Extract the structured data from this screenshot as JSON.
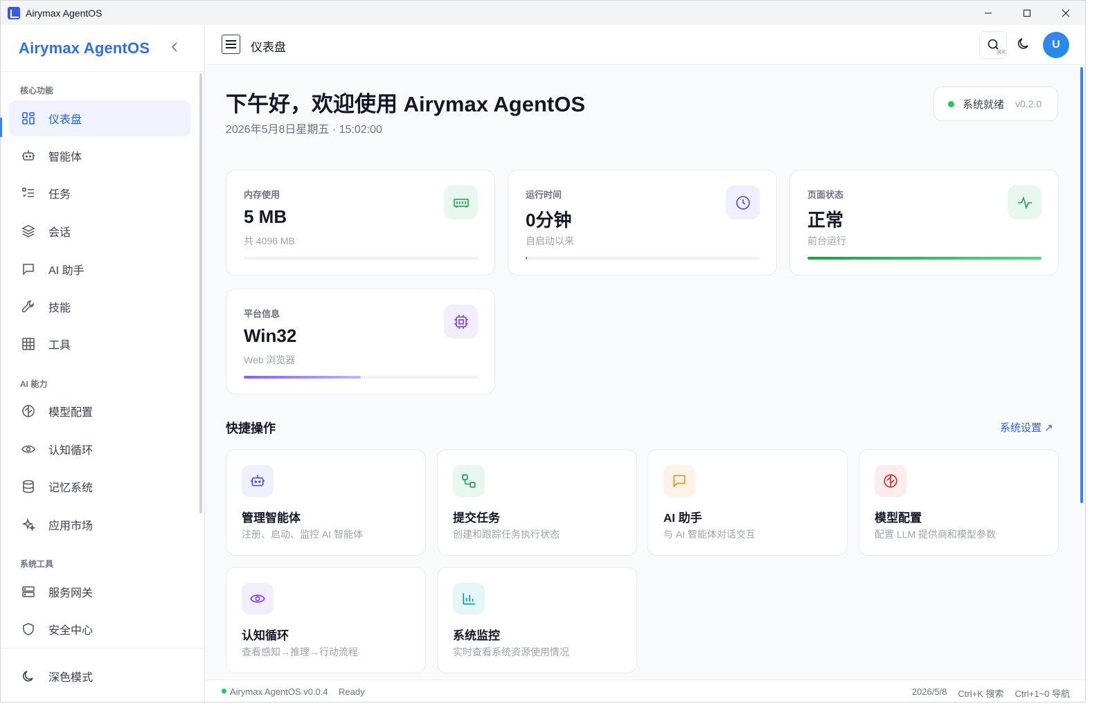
{
  "window": {
    "title": "Airymax AgentOS",
    "minimize": "—",
    "maximize": "☐",
    "close": "✕"
  },
  "sidebar": {
    "brand": "Airymax AgentOS",
    "collapse": "‹",
    "sections": [
      {
        "label": "核心功能"
      },
      {
        "label": "AI 能力"
      },
      {
        "label": "系统工具"
      }
    ],
    "items": [
      {
        "label": "仪表盘",
        "icon": "dashboard-icon",
        "active": true
      },
      {
        "label": "智能体",
        "icon": "robot-icon"
      },
      {
        "label": "任务",
        "icon": "task-list-icon"
      },
      {
        "label": "会话",
        "icon": "layers-icon"
      },
      {
        "label": "AI 助手",
        "icon": "chat-icon"
      },
      {
        "label": "技能",
        "icon": "wrench-icon"
      },
      {
        "label": "工具",
        "icon": "grid-icon"
      },
      {
        "label": "模型配置",
        "icon": "brain-icon"
      },
      {
        "label": "认知循环",
        "icon": "eye-icon"
      },
      {
        "label": "记忆系统",
        "icon": "database-icon"
      },
      {
        "label": "应用市场",
        "icon": "sparkles-icon"
      },
      {
        "label": "服务网关",
        "icon": "server-icon"
      },
      {
        "label": "安全中心",
        "icon": "shield-icon"
      }
    ],
    "dark_mode": "深色模式"
  },
  "topbar": {
    "title": "仪表盘",
    "search_shortcut": "⌘K",
    "avatar": "U"
  },
  "header": {
    "greeting": "下午好，欢迎使用 Airymax AgentOS",
    "datetime": "2026年5月8日星期五 · 15:02:00",
    "status": "系统就绪",
    "version": "v0.2.0"
  },
  "stats": [
    {
      "label": "内存使用",
      "value": "5 MB",
      "sub": "共 4096 MB",
      "icon": "memory-icon",
      "progress": 0
    },
    {
      "label": "运行时间",
      "value": "0分钟",
      "sub": "自启动以来",
      "icon": "clock-icon",
      "progress": 0.005
    },
    {
      "label": "页面状态",
      "value": "正常",
      "sub": "前台运行",
      "icon": "activity-icon",
      "progress": 1
    },
    {
      "label": "平台信息",
      "value": "Win32",
      "sub": "Web 浏览器",
      "icon": "cpu-icon",
      "progress": 0.5
    }
  ],
  "quick": {
    "title": "快捷操作",
    "link": "系统设置 ↗",
    "cards": [
      {
        "title": "管理智能体",
        "desc": "注册、启动、监控 AI 智能体",
        "icon": "robot-icon"
      },
      {
        "title": "提交任务",
        "desc": "创建和跟踪任务执行状态",
        "icon": "workflow-icon"
      },
      {
        "title": "AI 助手",
        "desc": "与 AI 智能体对话交互",
        "icon": "chat-icon"
      },
      {
        "title": "模型配置",
        "desc": "配置 LLM 提供商和模型参数",
        "icon": "brain-icon"
      },
      {
        "title": "认知循环",
        "desc": "查看感知→推理→行动流程",
        "icon": "eye-icon"
      },
      {
        "title": "系统监控",
        "desc": "实时查看系统资源使用情况",
        "icon": "bar-chart-icon"
      }
    ]
  },
  "statusbar": {
    "app": "Airymax AgentOS v0.0.4",
    "ready": "Ready",
    "date": "2026/5/8",
    "search_hint": "Ctrl+K 搜索",
    "nav_hint": "Ctrl+1~0 导航"
  },
  "colors": {
    "accent": "#2563eb",
    "brand": "#2f6fde",
    "green": "#22c55e",
    "purple": "#8b5cf6"
  }
}
